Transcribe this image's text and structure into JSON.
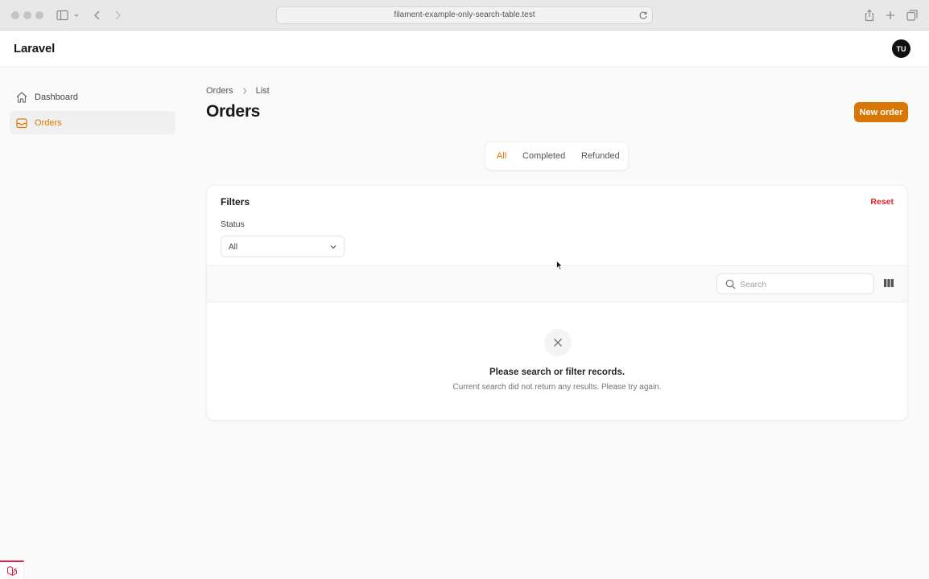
{
  "browser": {
    "url": "filament-example-only-search-table.test"
  },
  "app": {
    "brand": "Laravel",
    "avatar_initials": "TU",
    "accent_color": "#d97706"
  },
  "sidebar": {
    "items": [
      {
        "label": "Dashboard",
        "icon": "home-icon",
        "active": false
      },
      {
        "label": "Orders",
        "icon": "inbox-icon",
        "active": true
      }
    ]
  },
  "header": {
    "breadcrumb": [
      "Orders",
      "List"
    ],
    "title": "Orders",
    "new_button": "New order"
  },
  "tabs": [
    {
      "label": "All",
      "active": true
    },
    {
      "label": "Completed",
      "active": false
    },
    {
      "label": "Refunded",
      "active": false
    }
  ],
  "filters": {
    "title": "Filters",
    "reset": "Reset",
    "status_label": "Status",
    "status_value": "All"
  },
  "table": {
    "search_placeholder": "Search",
    "empty_heading": "Please search or filter records.",
    "empty_description": "Current search did not return any results. Please try again."
  }
}
